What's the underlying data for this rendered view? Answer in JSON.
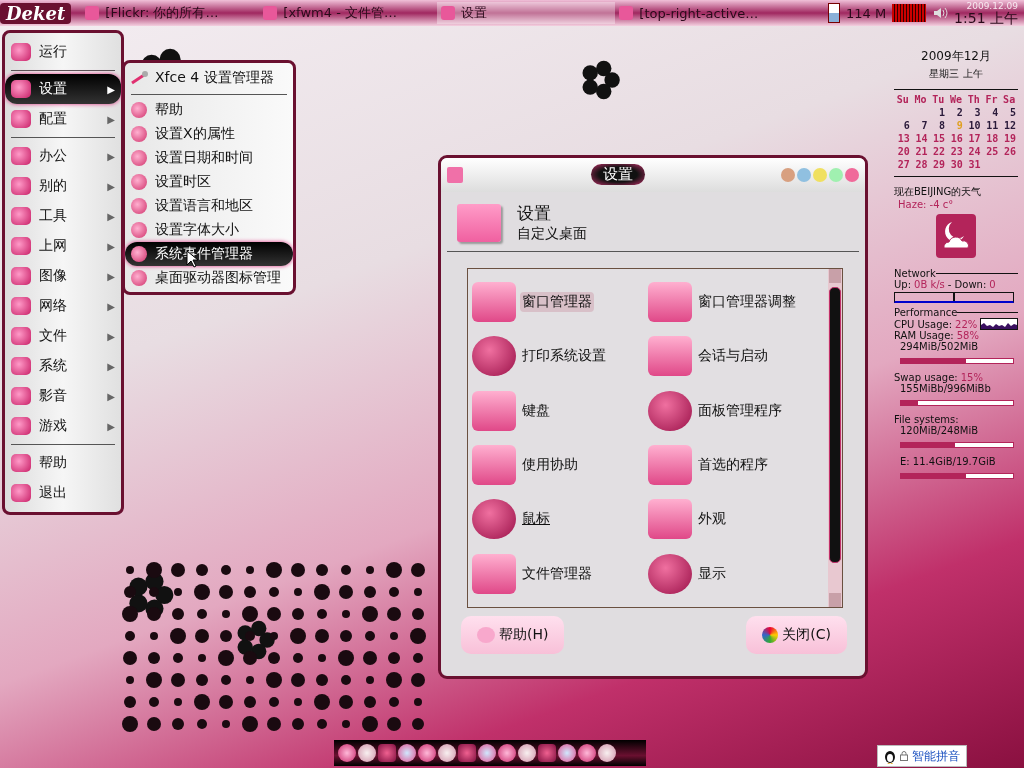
{
  "top_panel": {
    "logo": "Deket",
    "tasks": [
      {
        "label": "[Flickr: 你的所有…",
        "selected": false
      },
      {
        "label": "[xfwm4 - 文件管…",
        "selected": false
      },
      {
        "label": "设置",
        "selected": true
      },
      {
        "label": "[top-right-active…",
        "selected": false
      }
    ],
    "memory": "114 M",
    "date": "2009.12.09",
    "time": "1:51 上午"
  },
  "main_menu": {
    "groups": [
      [
        {
          "label": "运行",
          "submenu": false,
          "selected": false
        }
      ],
      [
        {
          "label": "设置",
          "submenu": true,
          "selected": true
        },
        {
          "label": "配置",
          "submenu": true,
          "selected": false
        }
      ],
      [
        {
          "label": "办公",
          "submenu": true,
          "selected": false
        },
        {
          "label": "别的",
          "submenu": true,
          "selected": false
        },
        {
          "label": "工具",
          "submenu": true,
          "selected": false
        },
        {
          "label": "上网",
          "submenu": true,
          "selected": false
        },
        {
          "label": "图像",
          "submenu": true,
          "selected": false
        },
        {
          "label": "网络",
          "submenu": true,
          "selected": false
        },
        {
          "label": "文件",
          "submenu": true,
          "selected": false
        },
        {
          "label": "系统",
          "submenu": true,
          "selected": false
        },
        {
          "label": "影音",
          "submenu": true,
          "selected": false
        },
        {
          "label": "游戏",
          "submenu": true,
          "selected": false
        }
      ],
      [
        {
          "label": "帮助",
          "submenu": false,
          "selected": false
        },
        {
          "label": "退出",
          "submenu": false,
          "selected": false
        }
      ]
    ],
    "arrow": "▶"
  },
  "submenu": {
    "header": "Xfce 4 设置管理器",
    "items": [
      {
        "label": "帮助",
        "selected": false
      },
      {
        "label": "设置X的属性",
        "selected": false
      },
      {
        "label": "设置日期和时间",
        "selected": false
      },
      {
        "label": "设置时区",
        "selected": false
      },
      {
        "label": "设置语言和地区",
        "selected": false
      },
      {
        "label": "设置字体大小",
        "selected": false
      },
      {
        "label": "系统事件管理器",
        "selected": true
      },
      {
        "label": "桌面驱动器图标管理",
        "selected": false
      }
    ]
  },
  "settings_window": {
    "title": "设置",
    "heading": "设置",
    "subheading": "自定义桌面",
    "items": [
      {
        "label": "窗口管理器",
        "selected": true,
        "focused": false
      },
      {
        "label": "窗口管理器调整",
        "selected": false,
        "focused": false
      },
      {
        "label": "打印系统设置",
        "selected": false,
        "focused": false
      },
      {
        "label": "会话与启动",
        "selected": false,
        "focused": false
      },
      {
        "label": "键盘",
        "selected": false,
        "focused": false
      },
      {
        "label": "面板管理程序",
        "selected": false,
        "focused": false
      },
      {
        "label": "使用协助",
        "selected": false,
        "focused": false
      },
      {
        "label": "首选的程序",
        "selected": false,
        "focused": false
      },
      {
        "label": "鼠标",
        "selected": false,
        "focused": true
      },
      {
        "label": "外观",
        "selected": false,
        "focused": false
      },
      {
        "label": "文件管理器",
        "selected": false,
        "focused": false
      },
      {
        "label": "显示",
        "selected": false,
        "focused": false
      }
    ],
    "buttons": [
      {
        "label": "帮助(H)",
        "kind": "help"
      },
      {
        "label": "关闭(C)",
        "kind": "close"
      }
    ]
  },
  "conky": {
    "month": "2009年12月",
    "weekday": "星期三 上午",
    "day_headers": [
      "Su",
      "Mo",
      "Tu",
      "We",
      "Th",
      "Fr",
      "Sa"
    ],
    "weeks": [
      {
        "color": "#2a1a3a",
        "kind": "lead",
        "days": [
          {
            "text": "1",
            "today": false
          },
          {
            "text": "2",
            "today": false
          },
          {
            "text": "3",
            "today": false
          },
          {
            "text": "4",
            "today": false
          },
          {
            "text": "5",
            "today": false
          }
        ]
      },
      {
        "color": "#2a1a3a",
        "kind": "tail",
        "days": [
          {
            "text": "6",
            "today": false
          },
          {
            "text": "7",
            "today": false
          },
          {
            "text": "8",
            "today": false
          },
          {
            "text": "9",
            "today": true
          },
          {
            "text": "10",
            "today": false
          },
          {
            "text": "11",
            "today": false
          },
          {
            "text": "12",
            "today": false
          }
        ]
      },
      {
        "color": "#b3245a",
        "kind": "tail",
        "days": [
          {
            "text": "13",
            "today": false
          },
          {
            "text": "14",
            "today": false
          },
          {
            "text": "15",
            "today": false
          },
          {
            "text": "16",
            "today": false
          },
          {
            "text": "17",
            "today": false
          },
          {
            "text": "18",
            "today": false
          },
          {
            "text": "19",
            "today": false
          }
        ]
      },
      {
        "color": "#b3245a",
        "kind": "tail",
        "days": [
          {
            "text": "20",
            "today": false
          },
          {
            "text": "21",
            "today": false
          },
          {
            "text": "22",
            "today": false
          },
          {
            "text": "23",
            "today": false
          },
          {
            "text": "24",
            "today": false
          },
          {
            "text": "25",
            "today": false
          },
          {
            "text": "26",
            "today": false
          }
        ]
      },
      {
        "color": "#b3245a",
        "kind": "tail",
        "days": [
          {
            "text": "27",
            "today": false
          },
          {
            "text": "28",
            "today": false
          },
          {
            "text": "29",
            "today": false
          },
          {
            "text": "30",
            "today": false
          },
          {
            "text": "31",
            "today": false
          }
        ]
      }
    ],
    "weather_title": "现在BEIJING的天气",
    "weather": "Haze: -4 c°",
    "network_title": "Network",
    "network": [
      {
        "text": "Up:",
        "kind": "label"
      },
      {
        "text": "0B  k/s",
        "kind": "value"
      },
      {
        "text": "- Down:",
        "kind": "label"
      },
      {
        "text": "0",
        "kind": "value"
      }
    ],
    "performance_title": "Performance",
    "cpu_label": "CPU Usage:",
    "cpu_value": "22%",
    "meters": [
      {
        "label": "RAM Usage:",
        "value": "58%",
        "detail": "294MiB/502MiB",
        "level": 0.58
      },
      {
        "label": "Swap usage:",
        "value": "15%",
        "detail": "155MiBb/996MiBb",
        "level": 0.15
      },
      {
        "label": "File systems:",
        "detail": "120MiB/248MiB",
        "level": 0.48
      },
      {
        "detail": "E: 11.4GiB/19.7GiB",
        "level": 0.58
      }
    ]
  },
  "ime": {
    "label": "智能拼音"
  }
}
